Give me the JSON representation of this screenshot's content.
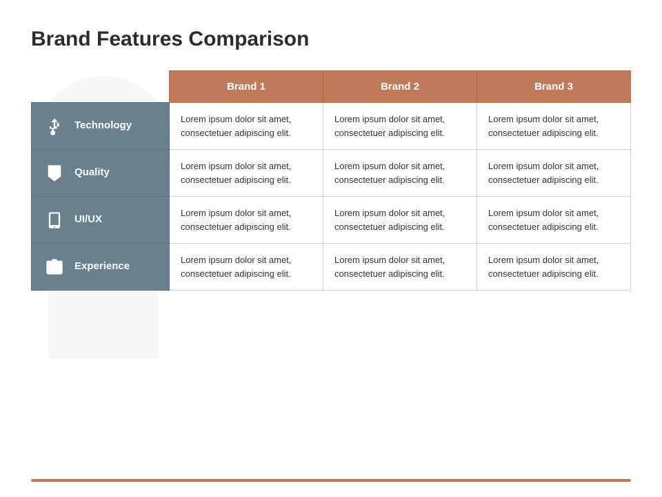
{
  "title": "Brand Features Comparison",
  "header": {
    "col1": "",
    "col2": "Brand 1",
    "col3": "Brand 2",
    "col4": "Brand 3"
  },
  "rows": [
    {
      "id": "technology",
      "label": "Technology",
      "icon": "usb",
      "col2": "Lorem ipsum dolor sit amet, consectetuer adipiscing elit.",
      "col3": "Lorem ipsum dolor sit amet, consectetuer adipiscing elit.",
      "col4": "Lorem ipsum dolor sit amet, consectetuer adipiscing elit."
    },
    {
      "id": "quality",
      "label": "Quality",
      "icon": "star-badge",
      "col2": "Lorem ipsum dolor sit amet, consectetuer adipiscing elit.",
      "col3": "Lorem ipsum dolor sit amet, consectetuer adipiscing elit.",
      "col4": "Lorem ipsum dolor sit amet, consectetuer adipiscing elit."
    },
    {
      "id": "uiux",
      "label": "UI/UX",
      "icon": "mobile",
      "col2": "Lorem ipsum dolor sit amet, consectetuer adipiscing elit.",
      "col3": "Lorem ipsum dolor sit amet, consectetuer adipiscing elit.",
      "col4": "Lorem ipsum dolor sit amet, consectetuer adipiscing elit."
    },
    {
      "id": "experience",
      "label": "Experience",
      "icon": "briefcase",
      "col2": "Lorem ipsum dolor sit amet, consectetuer adipiscing elit.",
      "col3": "Lorem ipsum dolor sit amet, consectetuer adipiscing elit.",
      "col4": "Lorem ipsum dolor sit amet, consectetuer adipiscing elit."
    }
  ],
  "colors": {
    "header_bg": "#c07a5a",
    "row_header_bg": "#6b7f8d",
    "accent_line": "#c07a5a"
  }
}
